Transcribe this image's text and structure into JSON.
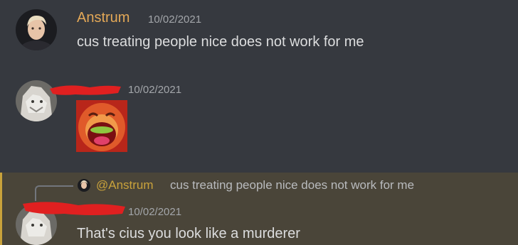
{
  "messages": [
    {
      "author": "Anstrum",
      "timestamp": "10/02/2021",
      "text": "cus treating people nice does not work for me"
    },
    {
      "author": "",
      "timestamp": "10/02/2021",
      "attachment": "laughing-face-image"
    },
    {
      "reply": {
        "mention": "@Anstrum",
        "text": "cus treating people nice does not work for me"
      },
      "author": "",
      "timestamp": "10/02/2021",
      "text": "That's cius you look like a murderer"
    }
  ],
  "colors": {
    "background": "#36393f",
    "author_name": "#e3a857",
    "mention_highlight": "#4a4539",
    "mention_bar": "#c9a23b",
    "redaction": "#e02020"
  }
}
